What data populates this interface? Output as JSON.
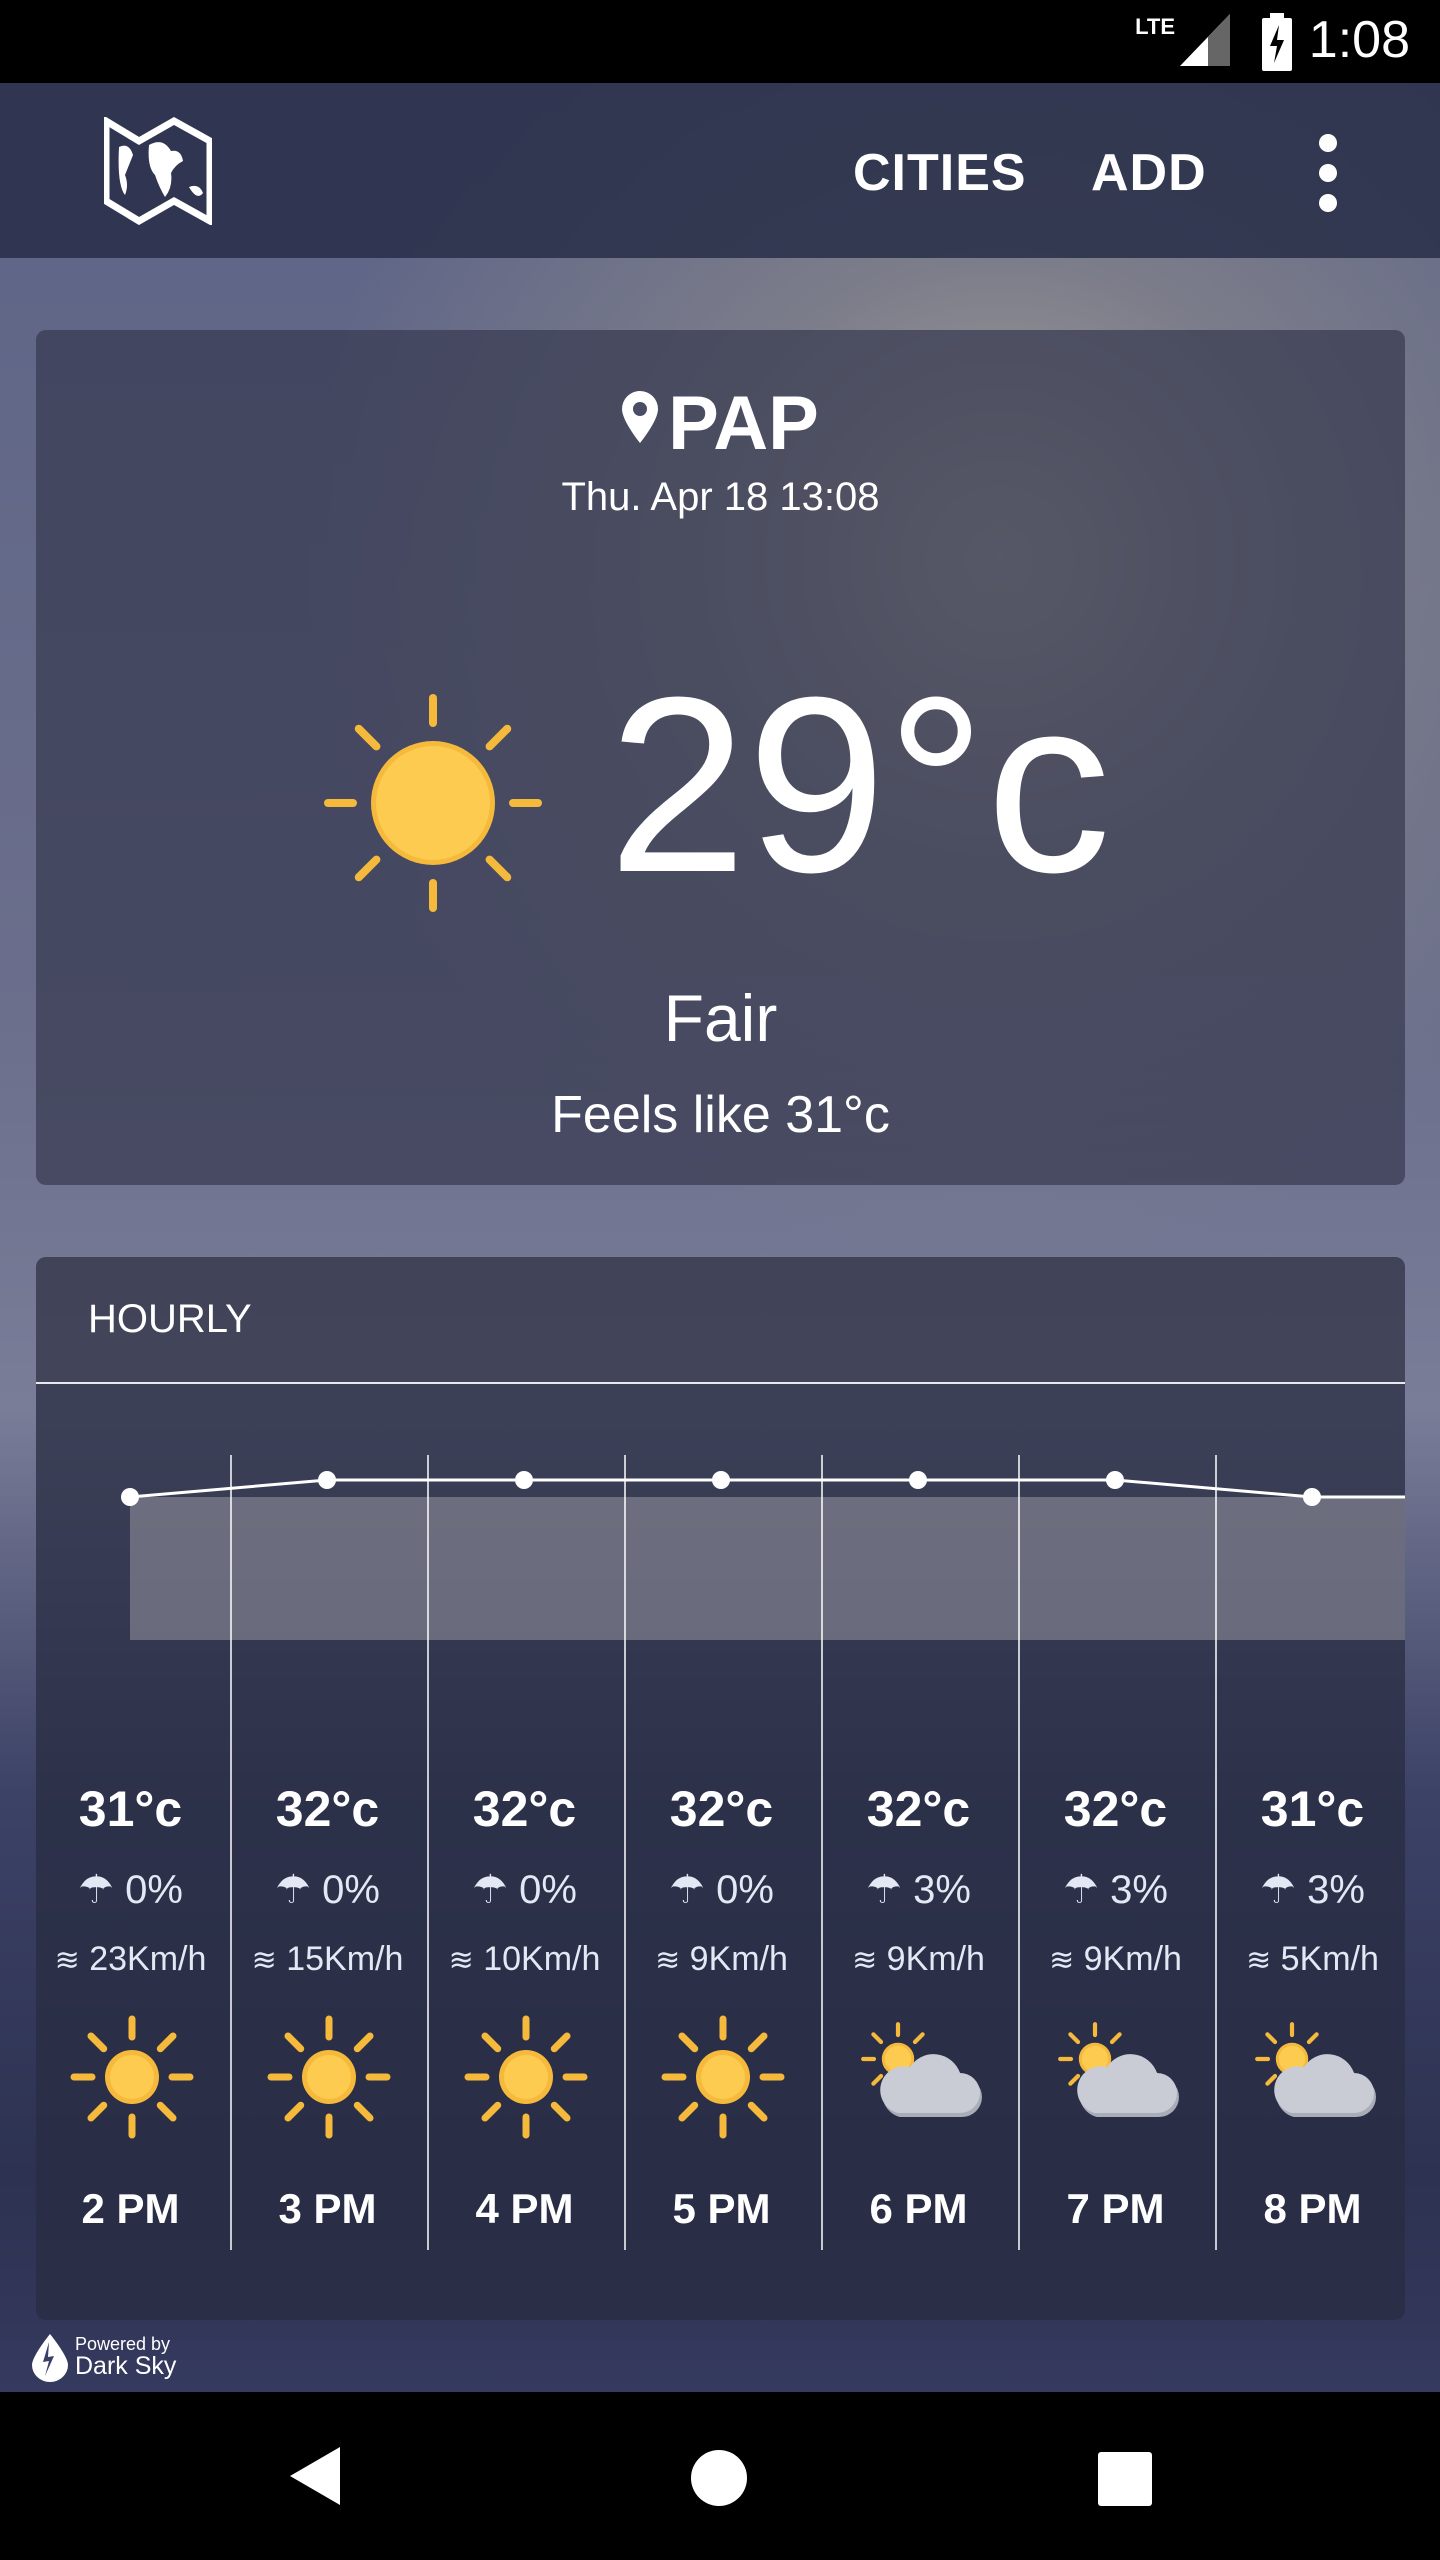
{
  "status_bar": {
    "network": "LTE",
    "time": "1:08"
  },
  "app_bar": {
    "logo": "world-map-icon",
    "actions": [
      "CITIES",
      "ADD"
    ],
    "menu": "more-vert-icon"
  },
  "current": {
    "location": "PAP",
    "datetime": "Thu. Apr 18 13:08",
    "temperature": "29°c",
    "condition": "Fair",
    "feels_like": "Feels like 31°c",
    "icon": "sun-icon"
  },
  "hourly": {
    "title": "HOURLY",
    "chart_data": {
      "type": "line",
      "x": [
        "2 PM",
        "3 PM",
        "4 PM",
        "5 PM",
        "6 PM",
        "7 PM",
        "8 PM"
      ],
      "values": [
        31,
        32,
        32,
        32,
        32,
        32,
        31
      ]
    },
    "items": [
      {
        "temp": "31°c",
        "precip": "0%",
        "wind": "23Km/h",
        "icon": "sun",
        "time": "2 PM"
      },
      {
        "temp": "32°c",
        "precip": "0%",
        "wind": "15Km/h",
        "icon": "sun",
        "time": "3 PM"
      },
      {
        "temp": "32°c",
        "precip": "0%",
        "wind": "10Km/h",
        "icon": "sun",
        "time": "4 PM"
      },
      {
        "temp": "32°c",
        "precip": "0%",
        "wind": "9Km/h",
        "icon": "sun",
        "time": "5 PM"
      },
      {
        "temp": "32°c",
        "precip": "3%",
        "wind": "9Km/h",
        "icon": "partly-cloudy",
        "time": "6 PM"
      },
      {
        "temp": "32°c",
        "precip": "3%",
        "wind": "9Km/h",
        "icon": "partly-cloudy",
        "time": "7 PM"
      },
      {
        "temp": "31°c",
        "precip": "3%",
        "wind": "5Km/h",
        "icon": "partly-cloudy",
        "time": "8 PM"
      }
    ]
  },
  "footer": {
    "powered": "Powered by",
    "brand": "Dark Sky"
  },
  "colors": {
    "sun": "#fdcb4f",
    "sun_ray": "#f5b93c",
    "cloud": "#c9ccd4"
  }
}
